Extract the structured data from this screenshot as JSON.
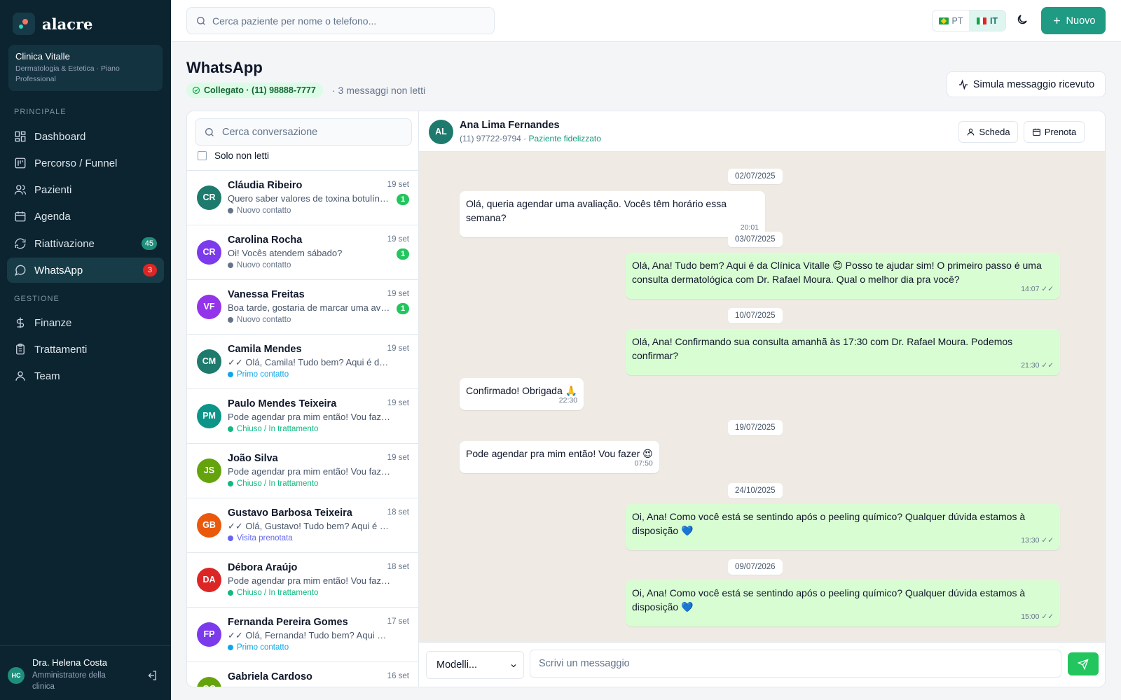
{
  "brand": {
    "name": "alacre"
  },
  "clinic": {
    "name": "Clinica Vitalle",
    "subtitle": "Dermatologia & Estetica · Piano Professional"
  },
  "sidebar": {
    "section_main": "PRINCIPALE",
    "section_manage": "GESTIONE",
    "items": [
      {
        "label": "Dashboard",
        "icon": "dashboard-icon"
      },
      {
        "label": "Percorso / Funnel",
        "icon": "funnel-icon"
      },
      {
        "label": "Pazienti",
        "icon": "users-icon"
      },
      {
        "label": "Agenda",
        "icon": "calendar-icon"
      },
      {
        "label": "Riattivazione",
        "icon": "refresh-icon",
        "badge": "45"
      },
      {
        "label": "WhatsApp",
        "icon": "chat-icon",
        "badge": "3",
        "active": true
      },
      {
        "label": "Finanze",
        "icon": "dollar-icon"
      },
      {
        "label": "Trattamenti",
        "icon": "clipboard-icon"
      },
      {
        "label": "Team",
        "icon": "user-icon"
      }
    ]
  },
  "user": {
    "initials": "HC",
    "name": "Dra. Helena Costa",
    "role": "Amministratore della clinica"
  },
  "topbar": {
    "search_placeholder": "Cerca paziente per nome o telefono...",
    "lang_pt": "PT",
    "lang_it": "IT",
    "new_label": "Nuovo"
  },
  "page": {
    "title": "WhatsApp",
    "status": "Collegato · (11) 98888-7777",
    "unread_note": "· 3 messaggi non letti",
    "simulate_label": "Simula messaggio ricevuto"
  },
  "conversations": {
    "search_placeholder": "Cerca conversazione",
    "unread_only_label": "Solo non letti",
    "items": [
      {
        "initials": "CR",
        "name": "Cláudia Ribeiro",
        "date": "19 set",
        "preview": "Quero saber valores de toxina botulínica",
        "unread": "1",
        "stage": "Nuovo contatto",
        "avatar_color": "#1d7a6c",
        "stage_color": "#64748b"
      },
      {
        "initials": "CR",
        "name": "Carolina Rocha",
        "date": "19 set",
        "preview": "Oi! Vocês atendem sábado?",
        "unread": "1",
        "stage": "Nuovo contatto",
        "avatar_color": "#7c3aed",
        "stage_color": "#64748b"
      },
      {
        "initials": "VF",
        "name": "Vanessa Freitas",
        "date": "19 set",
        "preview": "Boa tarde, gostaria de marcar uma avaliação",
        "unread": "1",
        "stage": "Nuovo contatto",
        "avatar_color": "#9333ea",
        "stage_color": "#64748b"
      },
      {
        "initials": "CM",
        "name": "Camila Mendes",
        "date": "19 set",
        "preview": "✓✓ Olá, Camila! Tudo bem? Aqui é da Clínica Vitalle",
        "unread": "",
        "stage": "Primo contatto",
        "avatar_color": "#1d7a6c",
        "stage_color": "#0ea5e9"
      },
      {
        "initials": "PM",
        "name": "Paulo Mendes Teixeira",
        "date": "19 set",
        "preview": "Pode agendar pra mim então! Vou fazer 😍",
        "unread": "",
        "stage": "Chiuso / In trattamento",
        "avatar_color": "#0d9488",
        "stage_color": "#10b981"
      },
      {
        "initials": "JS",
        "name": "João Silva",
        "date": "19 set",
        "preview": "Pode agendar pra mim então! Vou fazer 😍",
        "unread": "",
        "stage": "Chiuso / In trattamento",
        "avatar_color": "#65a30d",
        "stage_color": "#10b981"
      },
      {
        "initials": "GB",
        "name": "Gustavo Barbosa Teixeira",
        "date": "18 set",
        "preview": "✓✓ Olá, Gustavo! Tudo bem? Aqui é da Clínica Vitalle",
        "unread": "",
        "stage": "Visita prenotata",
        "avatar_color": "#ea580c",
        "stage_color": "#6366f1"
      },
      {
        "initials": "DA",
        "name": "Débora Araújo",
        "date": "18 set",
        "preview": "Pode agendar pra mim então! Vou fazer 😍",
        "unread": "",
        "stage": "Chiuso / In trattamento",
        "avatar_color": "#dc2626",
        "stage_color": "#10b981"
      },
      {
        "initials": "FP",
        "name": "Fernanda Pereira Gomes",
        "date": "17 set",
        "preview": "✓✓ Olá, Fernanda! Tudo bem? Aqui é da Clínica Vitalle",
        "unread": "",
        "stage": "Primo contatto",
        "avatar_color": "#7c3aed",
        "stage_color": "#0ea5e9"
      },
      {
        "initials": "GC",
        "name": "Gabriela Cardoso",
        "date": "16 set",
        "preview": "",
        "unread": "",
        "stage": "",
        "avatar_color": "#65a30d",
        "stage_color": "#10b981"
      }
    ]
  },
  "chat": {
    "initials": "AL",
    "name": "Ana Lima Fernandes",
    "phone": "(11) 97722-9794 ·",
    "status": "Paziente fidelizzato",
    "card_label": "Scheda",
    "book_label": "Prenota",
    "messages": [
      {
        "kind": "date",
        "text": "02/07/2025"
      },
      {
        "kind": "in",
        "text": "Olá, queria agendar uma avaliação. Vocês têm horário essa semana?",
        "time": "20:01"
      },
      {
        "kind": "date",
        "text": "03/07/2025"
      },
      {
        "kind": "out",
        "text": "Olá, Ana! Tudo bem? Aqui é da Clínica Vitalle 😊 Posso te ajudar sim! O primeiro passo é uma consulta dermatológica com Dr. Rafael Moura. Qual o melhor dia pra você?",
        "time": "14:07 ✓✓"
      },
      {
        "kind": "date",
        "text": "10/07/2025"
      },
      {
        "kind": "out",
        "text": "Olá, Ana! Confirmando sua consulta amanhã às 17:30 com Dr. Rafael Moura. Podemos confirmar?",
        "time": "21:30 ✓✓"
      },
      {
        "kind": "in",
        "text": "Confirmado! Obrigada 🙏",
        "time": "22:30"
      },
      {
        "kind": "date",
        "text": "19/07/2025"
      },
      {
        "kind": "in",
        "text": "Pode agendar pra mim então! Vou fazer 😍",
        "time": "07:50"
      },
      {
        "kind": "date",
        "text": "24/10/2025"
      },
      {
        "kind": "out",
        "text": "Oi, Ana! Como você está se sentindo após o peeling químico? Qualquer dúvida estamos à disposição 💙",
        "time": "13:30 ✓✓"
      },
      {
        "kind": "date",
        "text": "09/07/2026"
      },
      {
        "kind": "out",
        "text": "Oi, Ana! Como você está se sentindo após o peeling químico? Qualquer dúvida estamos à disposição 💙",
        "time": "15:00 ✓✓"
      }
    ],
    "template_label": "Modelli...",
    "message_placeholder": "Scrivi un messaggio"
  }
}
